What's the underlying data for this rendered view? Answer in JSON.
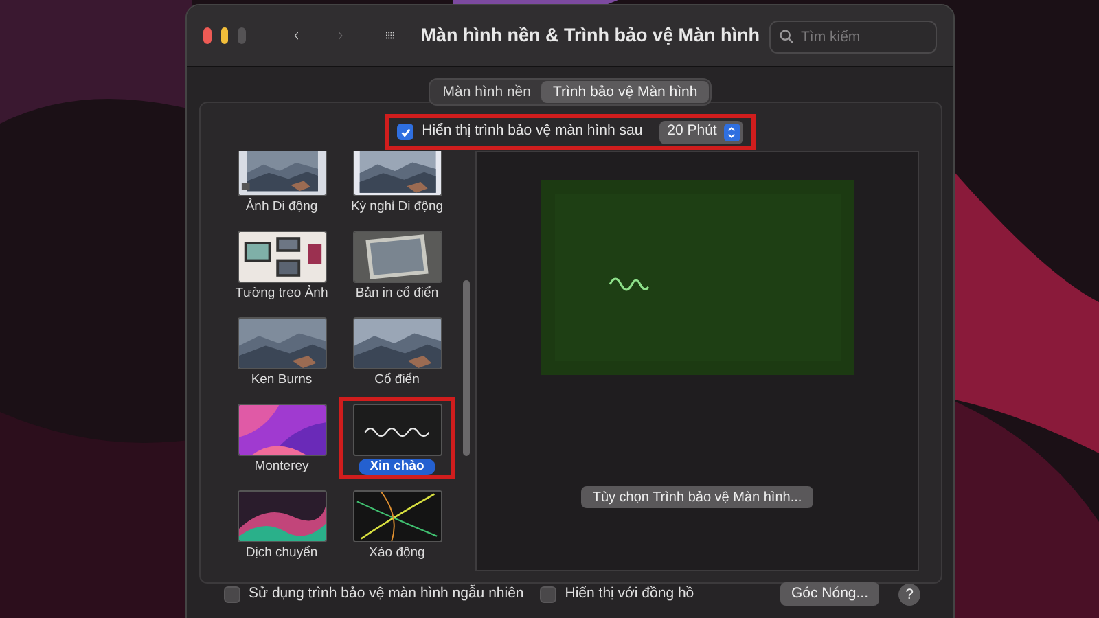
{
  "window": {
    "title": "Màn hình nền & Trình bảo vệ Màn hình"
  },
  "search": {
    "placeholder": "Tìm kiếm"
  },
  "tabs": [
    {
      "label": "Màn hình nền",
      "selected": false
    },
    {
      "label": "Trình bảo vệ Màn hình",
      "selected": true
    }
  ],
  "show_after": {
    "label": "Hiển thị trình bảo vệ màn hình sau",
    "checked": true,
    "value": "20 Phút"
  },
  "screensavers": [
    {
      "name": "Ảnh Di động",
      "selected": false
    },
    {
      "name": "Kỳ nghỉ Di động",
      "selected": false
    },
    {
      "name": "Tường treo Ảnh",
      "selected": false
    },
    {
      "name": "Bản in cổ điển",
      "selected": false
    },
    {
      "name": "Ken Burns",
      "selected": false
    },
    {
      "name": "Cổ điển",
      "selected": false
    },
    {
      "name": "Monterey",
      "selected": false
    },
    {
      "name": "Xin chào",
      "selected": true
    },
    {
      "name": "Dịch chuyển",
      "selected": false
    },
    {
      "name": "Xáo động",
      "selected": false
    }
  ],
  "options_button": "Tùy chọn Trình bảo vệ Màn hình...",
  "random": {
    "label": "Sử dụng trình bảo vệ màn hình ngẫu nhiên",
    "checked": false
  },
  "clock": {
    "label": "Hiển thị với đồng hồ",
    "checked": false
  },
  "hot_corners_button": "Góc Nóng...",
  "help_button": "?"
}
